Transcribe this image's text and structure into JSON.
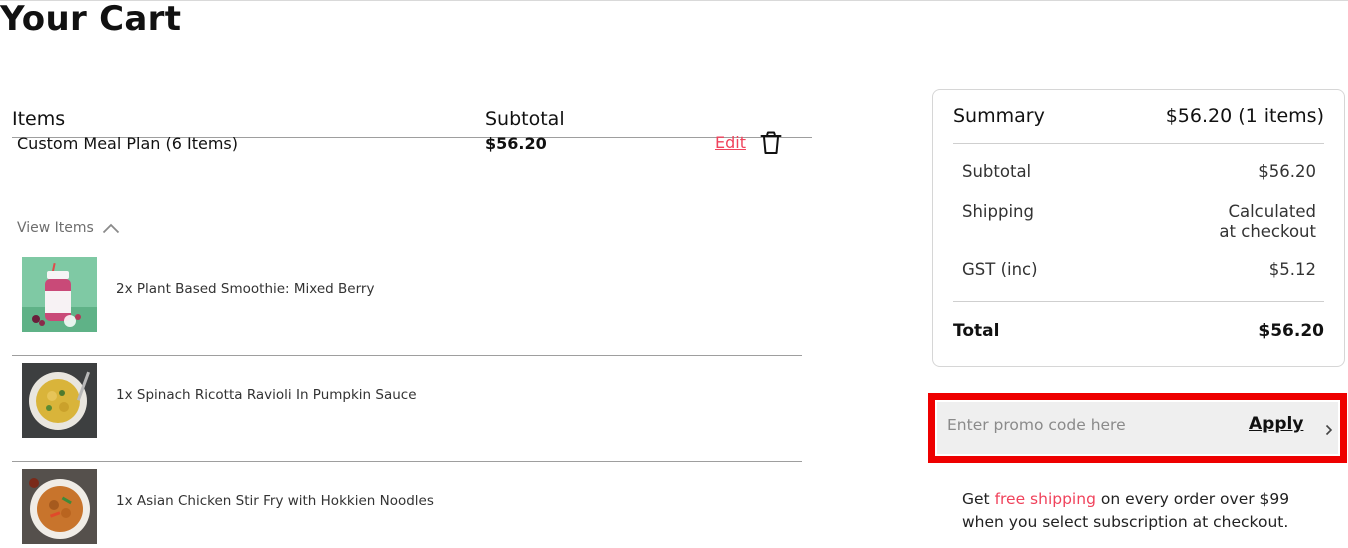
{
  "page": {
    "title": "Your Cart"
  },
  "cart": {
    "headers": {
      "items": "Items",
      "subtotal": "Subtotal"
    },
    "line_item": {
      "name": "Custom Meal Plan (6 Items)",
      "price": "$56.20",
      "edit_label": "Edit",
      "view_items_label": "View Items"
    },
    "products": [
      {
        "name": "2x Plant Based Smoothie: Mixed Berry"
      },
      {
        "name": "1x Spinach Ricotta Ravioli In Pumpkin Sauce"
      },
      {
        "name": "1x Asian Chicken Stir Fry with Hokkien Noodles"
      }
    ]
  },
  "summary": {
    "title": "Summary",
    "header_value": "$56.20 (1 items)",
    "subtotal_label": "Subtotal",
    "subtotal_value": "$56.20",
    "shipping_label": "Shipping",
    "shipping_value_line1": "Calculated",
    "shipping_value_line2": "at checkout",
    "gst_label": "GST (inc)",
    "gst_value": "$5.12",
    "total_label": "Total",
    "total_value": "$56.20"
  },
  "promo": {
    "placeholder": "Enter promo code here",
    "value": "",
    "apply_label": "Apply"
  },
  "shipping_note": {
    "prefix": "Get ",
    "highlight": "free shipping",
    "suffix_line1": " on every order over $99",
    "line2": "when you select subscription at checkout."
  },
  "colors": {
    "accent": "#f0435c",
    "highlight_outline": "#ee0000",
    "promo_bg": "#efefef"
  }
}
